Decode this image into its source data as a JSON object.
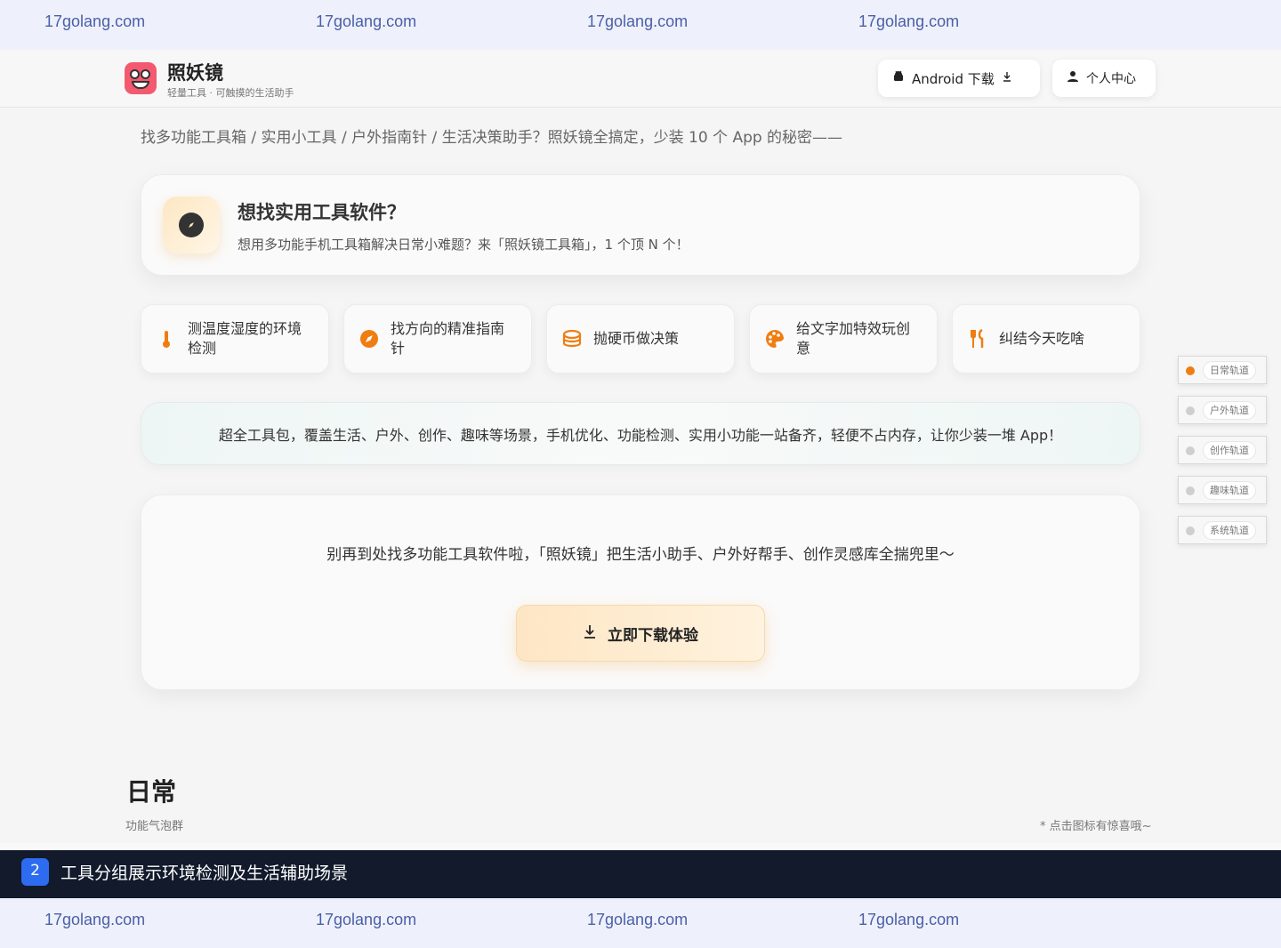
{
  "watermarks": {
    "top": [
      "17golang.com",
      "17golang.com",
      "17golang.com",
      "17golang.com"
    ],
    "bottom": [
      "17golang.com",
      "17golang.com",
      "17golang.com",
      "17golang.com"
    ]
  },
  "header": {
    "brand_name": "照妖镜",
    "brand_tagline": "轻量工具 · 可触摸的生活助手",
    "android_label": "Android 下载",
    "user_label": "个人中心"
  },
  "breadcrumb": "找多功能工具箱 / 实用小工具 / 户外指南针 / 生活决策助手？照妖镜全搞定，少装 10 个 App 的秘密——",
  "intro": {
    "title": "想找实用工具软件？",
    "desc": "想用多功能手机工具箱解决日常小难题？来「照妖镜工具箱」，1 个顶 N 个！"
  },
  "features": [
    {
      "label": "测温度湿度的环境检测",
      "icon": "thermometer-icon"
    },
    {
      "label": "找方向的精准指南针",
      "icon": "compass-icon"
    },
    {
      "label": "抛硬币做决策",
      "icon": "coin-stack-icon"
    },
    {
      "label": "给文字加特效玩创意",
      "icon": "palette-icon"
    },
    {
      "label": "纠结今天吃啥",
      "icon": "utensils-icon"
    }
  ],
  "banner": "超全工具包，覆盖生活、户外、创作、趣味等场景，手机优化、功能检测、实用小功能一站备齐，轻便不占内存，让你少装一堆 App！",
  "cta": {
    "text": "别再到处找多功能工具软件啦，「照妖镜」把生活小助手、户外好帮手、创作灵感库全揣兜里～",
    "button": "立即下载体验"
  },
  "rail": [
    {
      "label": "日常轨道",
      "active": true
    },
    {
      "label": "户外轨道",
      "active": false
    },
    {
      "label": "创作轨道",
      "active": false
    },
    {
      "label": "趣味轨道",
      "active": false
    },
    {
      "label": "系统轨道",
      "active": false
    }
  ],
  "section": {
    "title": "日常",
    "subtitle": "功能气泡群",
    "hint": "* 点击图标有惊喜哦~"
  },
  "caption": {
    "number": "2",
    "text": "工具分组展示环境检测及生活辅助场景"
  },
  "colors": {
    "accent": "#f07d12",
    "caption_bg": "#121a2c",
    "caption_badge": "#2d6cf0",
    "watermark": "#4a5fa8"
  }
}
